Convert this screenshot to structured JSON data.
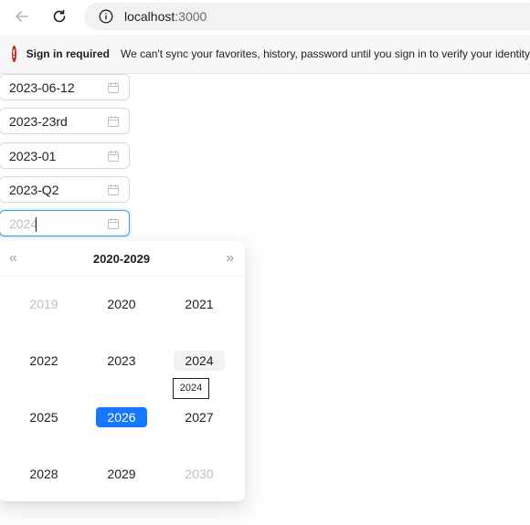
{
  "browser": {
    "url_host": "localhost",
    "url_port": ":3000"
  },
  "banner": {
    "title": "Sign in required",
    "message": "We can't sync your favorites, history, password until you sign in to verify your identity"
  },
  "pickers": [
    {
      "value": "2023-06-12"
    },
    {
      "value": "2023-23rd"
    },
    {
      "value": "2023-01"
    },
    {
      "value": "2023-Q2"
    },
    {
      "value": "2024"
    }
  ],
  "panel": {
    "decade_label": "2020-2029",
    "years": [
      "2019",
      "2020",
      "2021",
      "2022",
      "2023",
      "2024",
      "2025",
      "2026",
      "2027",
      "2028",
      "2029",
      "2030"
    ],
    "selected_year": "2026",
    "hovered_year": "2024",
    "tooltip": "2024"
  },
  "icons": {
    "back": "arrow-left-icon",
    "refresh": "refresh-icon",
    "info": "info-icon",
    "error": "error-icon",
    "calendar": "calendar-icon",
    "prev": "double-chevron-left-icon",
    "next": "double-chevron-right-icon"
  },
  "colors": {
    "accent": "#1677ff",
    "error": "#c42b1c",
    "focus_border": "#4096ff"
  }
}
